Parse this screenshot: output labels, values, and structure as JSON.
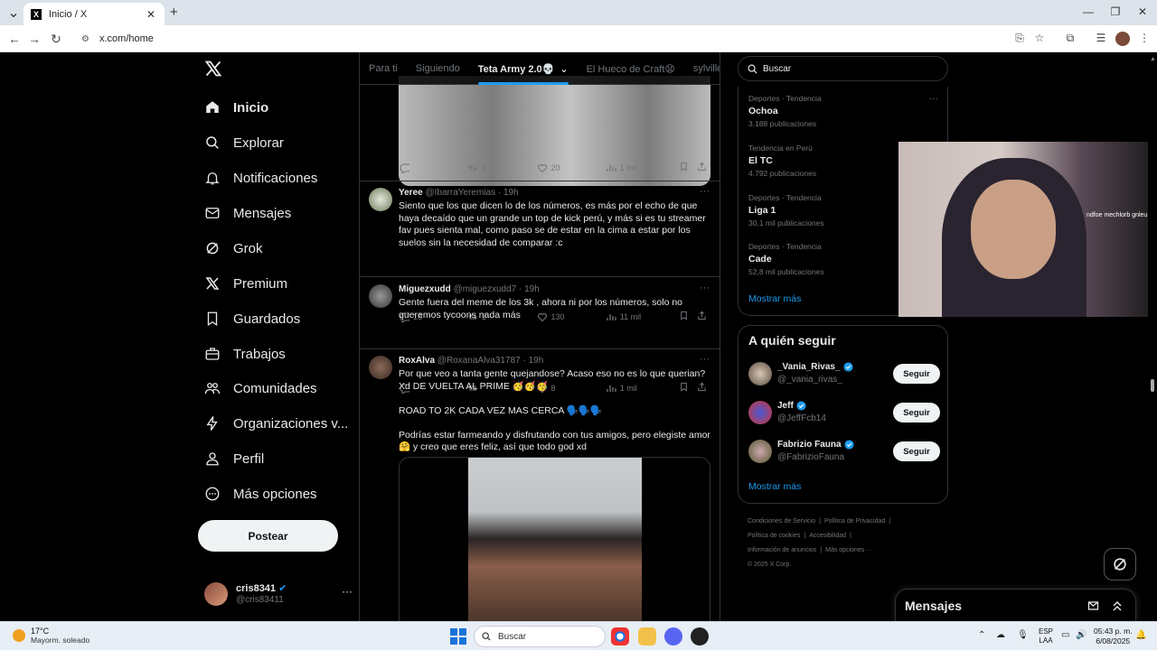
{
  "browser": {
    "tab_title": "Inicio / X",
    "url": "x.com/home",
    "new_tab_icon": "plus-icon"
  },
  "nav": {
    "items": [
      {
        "label": "Inicio",
        "icon": "home-icon",
        "bold": true
      },
      {
        "label": "Explorar",
        "icon": "search-icon"
      },
      {
        "label": "Notificaciones",
        "icon": "bell-icon"
      },
      {
        "label": "Mensajes",
        "icon": "envelope-icon"
      },
      {
        "label": "Grok",
        "icon": "grok-icon"
      },
      {
        "label": "Premium",
        "icon": "x-icon"
      },
      {
        "label": "Guardados",
        "icon": "bookmark-icon"
      },
      {
        "label": "Trabajos",
        "icon": "briefcase-icon"
      },
      {
        "label": "Comunidades",
        "icon": "people-icon"
      },
      {
        "label": "Organizaciones v...",
        "icon": "lightning-icon"
      },
      {
        "label": "Perfil",
        "icon": "person-icon"
      },
      {
        "label": "Más opciones",
        "icon": "more-circle-icon"
      }
    ],
    "post_label": "Postear",
    "account": {
      "name": "cris8341",
      "handle": "@cris83411"
    }
  },
  "feed": {
    "tabs": [
      "Para ti",
      "Siguiendo",
      "Teta Army 2.0💀",
      "El Hueco de Craft😧",
      "sylville"
    ],
    "active_tab": 2,
    "first_actions": {
      "reply": "",
      "repost": "1",
      "like": "20",
      "views": "1 mil"
    },
    "tweets": [
      {
        "name": "Yeree",
        "handle": "@IbarraYeremias",
        "time": "· 19h",
        "text": "Siento que los que dicen lo de los números, es más por el echo de que haya decaído que un grande un top de kick perú, y más si es tu streamer fav pues sienta mal, como paso se de estar en la cima a estar por los suelos sin la necesidad de comparar :c",
        "actions": {
          "reply": "18",
          "repost": "2",
          "like": "130",
          "views": "11 mil"
        }
      },
      {
        "name": "Miguezxudd",
        "handle": "@miguezxudd7",
        "time": "· 19h",
        "text": "Gente fuera del meme de los 3k , ahora ni por los números,  solo no queremos tycoons nada más",
        "actions": {
          "reply": "",
          "repost": "",
          "like": "8",
          "views": "1 mil"
        }
      },
      {
        "name": "RoxAlva",
        "handle": "@RoxanaAlva31787",
        "time": "· 19h",
        "text": "Por que veo a tanta gente quejandose? Acaso eso no es lo que querian? Xd DE VUELTA AL PRIME 🥳🥳🥳\n\nROAD TO 2K CADA VEZ MAS CERCA 🗣️🗣️🗣️\n\nPodrías estar farmeando y disfrutando con tus amigos, pero elegiste amor 🤗 y creo que eres feliz, así que todo god xd",
        "actions": {
          "reply": "",
          "repost": "",
          "like": "",
          "views": ""
        }
      }
    ]
  },
  "right": {
    "search_placeholder": "Buscar",
    "trends": [
      {
        "category": "Deportes · Tendencia",
        "name": "Ochoa",
        "count": "3.188 publicaciones"
      },
      {
        "category": "Tendencia en Perú",
        "name": "El TC",
        "count": "4.792 publicaciones"
      },
      {
        "category": "Deportes · Tendencia",
        "name": "Liga 1",
        "count": "30,1 mil publicaciones"
      },
      {
        "category": "Deportes · Tendencia",
        "name": "Cade",
        "count": "52,8 mil publicaciones"
      }
    ],
    "show_more": "Mostrar más",
    "who_to_follow_title": "A quién seguir",
    "users": [
      {
        "name": "_Vania_Rivas_",
        "handle": "@_vania_rivas_",
        "verified": true
      },
      {
        "name": "Jeff",
        "handle": "@JeffFcb14",
        "verified": true
      },
      {
        "name": "Fabrizio Fauna",
        "handle": "@FabrizioFauna",
        "verified": true
      }
    ],
    "follow_label": "Seguir",
    "footer": [
      "Condiciones de Servicio",
      "|",
      "Política de Privacidad",
      "|",
      "Política de cookies",
      "|",
      "Accesibilidad",
      "|",
      "Información de anuncios",
      "|",
      "Más opciones ···",
      "© 2025 X Corp."
    ]
  },
  "messages": {
    "title": "Mensajes"
  },
  "webcam": {
    "mirrored_text": "ndfoe mechlorb gnleu"
  },
  "taskbar": {
    "temp": "17°C",
    "weather": "Mayorm. soleado",
    "search": "Buscar",
    "lang1": "ESP",
    "lang2": "LAA",
    "time": "05:43 p. m.",
    "date": "6/08/2025"
  },
  "colors": {
    "accent": "#1d9bf0",
    "bg": "#000000",
    "text": "#e7e9ea",
    "muted": "#71767b",
    "border": "#2f3336"
  }
}
